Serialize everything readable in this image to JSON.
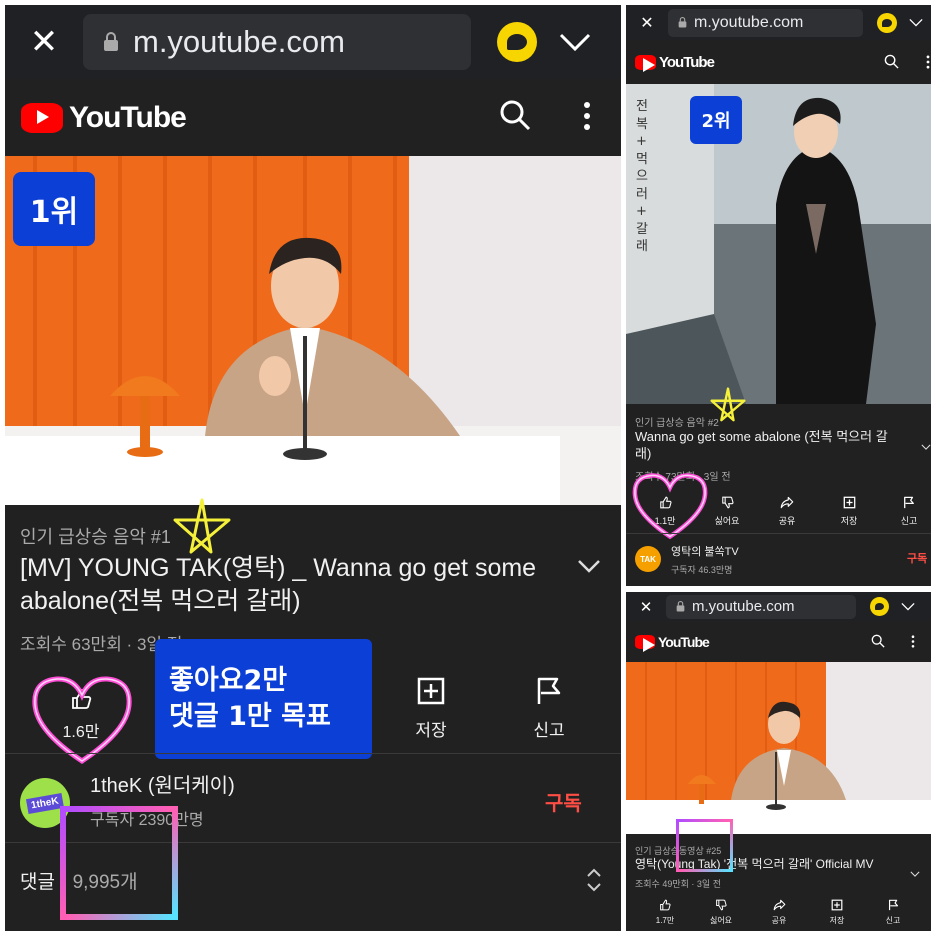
{
  "panel1": {
    "url": "m.youtube.com",
    "brand": "YouTube",
    "rank_badge": "1위",
    "trending": "인기 급상승 음악 #1",
    "title_line1": "[MV] YOUNG TAK(영탁) _ Wanna go get some",
    "title_line2": "abalone(전복 먹으러 갈래)",
    "meta": "조회수 63만회 · 3일 전",
    "like_count": "1.6만",
    "goal_line1": "좋아요2만",
    "goal_line2": "댓글 1만 목표",
    "save_label": "저장",
    "report_label": "신고",
    "channel_name": "1theK (원더케이)",
    "channel_avatar_text": "1theK",
    "subscribers": "구독자 2390만명",
    "subscribe_label": "구독",
    "comments_label": "댓글",
    "comments_count": "· 9,995개"
  },
  "panel2": {
    "url": "m.youtube.com",
    "brand": "YouTube",
    "rank_badge": "2위",
    "poster_text": "전복 + 먹으러 + 갈래",
    "trending": "인기 급상승 음악 #2",
    "title_line1": "Wanna go get some abalone (전복 먹으러 갈",
    "title_line2": "래)",
    "meta": "조회수 73만회 · 3일 전",
    "like_count": "1.1만",
    "dislike_label": "싫어요",
    "share_label": "공유",
    "save_label": "저장",
    "report_label": "신고",
    "channel_name": "영탁의 불쏙TV",
    "channel_avatar_text": "TAK",
    "subscribers": "구독자 46.3만명",
    "subscribe_label": "구독"
  },
  "panel3": {
    "url": "m.youtube.com",
    "brand": "YouTube",
    "trending": "인기 급상승동영상 #25",
    "title": "영탁(Young Tak) '전복 먹으러 갈래' Official MV",
    "meta": "조회수 49만회 · 3일 전",
    "like_count": "1.7만",
    "dislike_label": "싫어요",
    "share_label": "공유",
    "save_label": "저장",
    "report_label": "신고"
  },
  "colors": {
    "youtube_red": "#ff0000",
    "rank_blue": "#0b3fd6",
    "neon_pink": "#ff4fd8",
    "star_yellow": "#f5f03a",
    "subscribe_red": "#ff4e45"
  }
}
